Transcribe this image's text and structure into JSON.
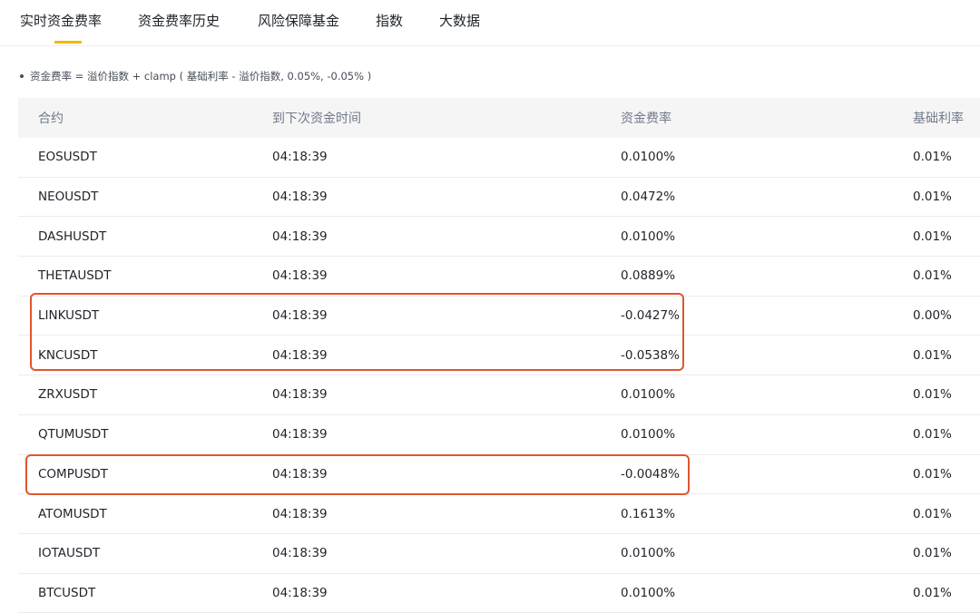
{
  "tabs": [
    {
      "label": "实时资金费率",
      "active": true
    },
    {
      "label": "资金费率历史",
      "active": false
    },
    {
      "label": "风险保障基金",
      "active": false
    },
    {
      "label": "指数",
      "active": false
    },
    {
      "label": "大数据",
      "active": false
    }
  ],
  "formula": "资金费率 = 溢价指数 + clamp ( 基础利率 - 溢价指数, 0.05%, -0.05% )",
  "table": {
    "headers": [
      "合约",
      "到下次资金时间",
      "资金费率",
      "基础利率"
    ],
    "rows": [
      [
        "EOSUSDT",
        "04:18:39",
        "0.0100%",
        "0.01%"
      ],
      [
        "NEOUSDT",
        "04:18:39",
        "0.0472%",
        "0.01%"
      ],
      [
        "DASHUSDT",
        "04:18:39",
        "0.0100%",
        "0.01%"
      ],
      [
        "THETAUSDT",
        "04:18:39",
        "0.0889%",
        "0.01%"
      ],
      [
        "LINKUSDT",
        "04:18:39",
        "-0.0427%",
        "0.00%"
      ],
      [
        "KNCUSDT",
        "04:18:39",
        "-0.0538%",
        "0.01%"
      ],
      [
        "ZRXUSDT",
        "04:18:39",
        "0.0100%",
        "0.01%"
      ],
      [
        "QTUMUSDT",
        "04:18:39",
        "0.0100%",
        "0.01%"
      ],
      [
        "COMPUSDT",
        "04:18:39",
        "-0.0048%",
        "0.01%"
      ],
      [
        "ATOMUSDT",
        "04:18:39",
        "0.1613%",
        "0.01%"
      ],
      [
        "IOTAUSDT",
        "04:18:39",
        "0.0100%",
        "0.01%"
      ],
      [
        "BTCUSDT",
        "04:18:39",
        "0.0100%",
        "0.01%"
      ]
    ]
  },
  "colors": {
    "accent": "#f0b90b",
    "highlight": "#e0562f"
  }
}
